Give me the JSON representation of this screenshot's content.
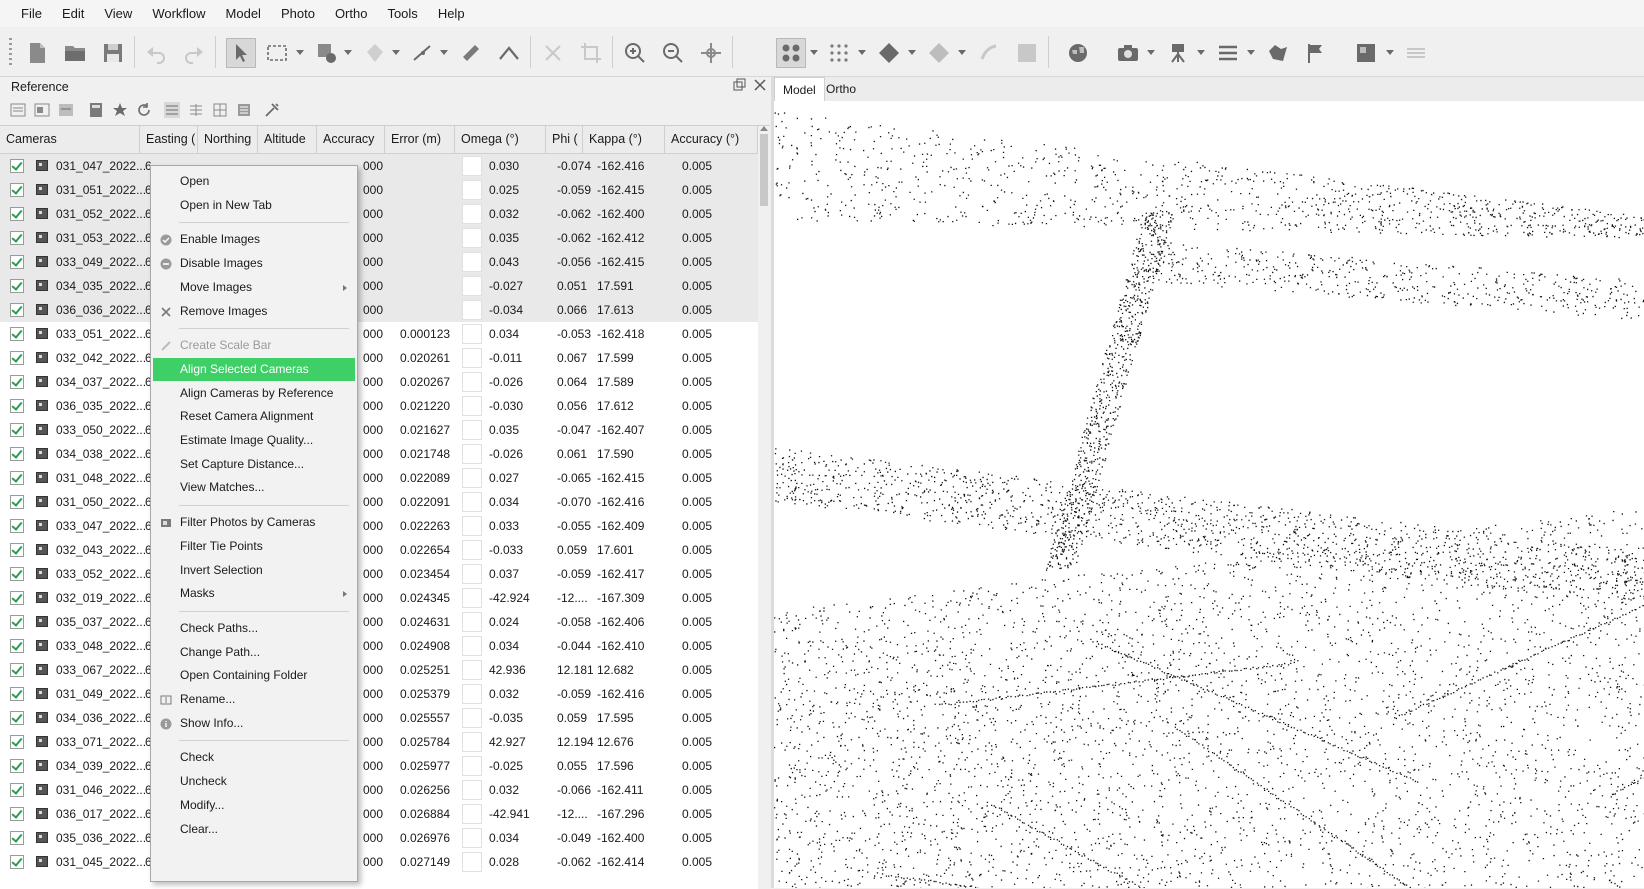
{
  "menubar": [
    "File",
    "Edit",
    "View",
    "Workflow",
    "Model",
    "Photo",
    "Ortho",
    "Tools",
    "Help"
  ],
  "panel": {
    "title": "Reference"
  },
  "columns": [
    "Cameras",
    "Easting (",
    "Northing",
    "Altitude",
    "Accuracy",
    "Error (m)",
    "Omega (°)",
    "Phi (",
    "Kappa (°)",
    "Accuracy (°)"
  ],
  "rows": [
    {
      "name": "031_047_2022...",
      "east": "6",
      "acc": "000",
      "err": "",
      "omega": "0.030",
      "phi": "-0.074",
      "kappa": "-162.416",
      "acc2": "0.005",
      "sel": true
    },
    {
      "name": "031_051_2022...",
      "east": "6",
      "acc": "000",
      "err": "",
      "omega": "0.025",
      "phi": "-0.059",
      "kappa": "-162.415",
      "acc2": "0.005",
      "sel": true
    },
    {
      "name": "031_052_2022...",
      "east": "6",
      "acc": "000",
      "err": "",
      "omega": "0.032",
      "phi": "-0.062",
      "kappa": "-162.400",
      "acc2": "0.005",
      "sel": true
    },
    {
      "name": "031_053_2022...",
      "east": "6",
      "acc": "000",
      "err": "",
      "omega": "0.035",
      "phi": "-0.062",
      "kappa": "-162.412",
      "acc2": "0.005",
      "sel": true
    },
    {
      "name": "033_049_2022...",
      "east": "6",
      "acc": "000",
      "err": "",
      "omega": "0.043",
      "phi": "-0.056",
      "kappa": "-162.415",
      "acc2": "0.005",
      "sel": true
    },
    {
      "name": "034_035_2022...",
      "east": "6",
      "acc": "000",
      "err": "",
      "omega": "-0.027",
      "phi": "0.051",
      "kappa": "17.591",
      "acc2": "0.005",
      "sel": true
    },
    {
      "name": "036_036_2022...",
      "east": "6",
      "acc": "000",
      "err": "",
      "omega": "-0.034",
      "phi": "0.066",
      "kappa": "17.613",
      "acc2": "0.005",
      "sel": true
    },
    {
      "name": "033_051_2022...",
      "east": "6",
      "acc": "000",
      "err": "0.000123",
      "omega": "0.034",
      "phi": "-0.053",
      "kappa": "-162.418",
      "acc2": "0.005",
      "sel": false
    },
    {
      "name": "032_042_2022...",
      "east": "6",
      "acc": "000",
      "err": "0.020261",
      "omega": "-0.011",
      "phi": "0.067",
      "kappa": "17.599",
      "acc2": "0.005",
      "sel": false
    },
    {
      "name": "034_037_2022...",
      "east": "6",
      "acc": "000",
      "err": "0.020267",
      "omega": "-0.026",
      "phi": "0.064",
      "kappa": "17.589",
      "acc2": "0.005",
      "sel": false
    },
    {
      "name": "036_035_2022...",
      "east": "6",
      "acc": "000",
      "err": "0.021220",
      "omega": "-0.030",
      "phi": "0.056",
      "kappa": "17.612",
      "acc2": "0.005",
      "sel": false
    },
    {
      "name": "033_050_2022...",
      "east": "6",
      "acc": "000",
      "err": "0.021627",
      "omega": "0.035",
      "phi": "-0.047",
      "kappa": "-162.407",
      "acc2": "0.005",
      "sel": false
    },
    {
      "name": "034_038_2022...",
      "east": "6",
      "acc": "000",
      "err": "0.021748",
      "omega": "-0.026",
      "phi": "0.061",
      "kappa": "17.590",
      "acc2": "0.005",
      "sel": false
    },
    {
      "name": "031_048_2022...",
      "east": "6",
      "acc": "000",
      "err": "0.022089",
      "omega": "0.027",
      "phi": "-0.065",
      "kappa": "-162.415",
      "acc2": "0.005",
      "sel": false
    },
    {
      "name": "031_050_2022...",
      "east": "6",
      "acc": "000",
      "err": "0.022091",
      "omega": "0.034",
      "phi": "-0.070",
      "kappa": "-162.416",
      "acc2": "0.005",
      "sel": false
    },
    {
      "name": "033_047_2022...",
      "east": "6",
      "acc": "000",
      "err": "0.022263",
      "omega": "0.033",
      "phi": "-0.055",
      "kappa": "-162.409",
      "acc2": "0.005",
      "sel": false
    },
    {
      "name": "032_043_2022...",
      "east": "6",
      "acc": "000",
      "err": "0.022654",
      "omega": "-0.033",
      "phi": "0.059",
      "kappa": "17.601",
      "acc2": "0.005",
      "sel": false
    },
    {
      "name": "033_052_2022...",
      "east": "6",
      "acc": "000",
      "err": "0.023454",
      "omega": "0.037",
      "phi": "-0.059",
      "kappa": "-162.417",
      "acc2": "0.005",
      "sel": false
    },
    {
      "name": "032_019_2022...",
      "east": "6",
      "acc": "000",
      "err": "0.024345",
      "omega": "-42.924",
      "phi": "-12....",
      "kappa": "-167.309",
      "acc2": "0.005",
      "sel": false
    },
    {
      "name": "035_037_2022...",
      "east": "6",
      "acc": "000",
      "err": "0.024631",
      "omega": "0.024",
      "phi": "-0.058",
      "kappa": "-162.406",
      "acc2": "0.005",
      "sel": false
    },
    {
      "name": "033_048_2022...",
      "east": "6",
      "acc": "000",
      "err": "0.024908",
      "omega": "0.034",
      "phi": "-0.044",
      "kappa": "-162.410",
      "acc2": "0.005",
      "sel": false
    },
    {
      "name": "033_067_2022...",
      "east": "6",
      "acc": "000",
      "err": "0.025251",
      "omega": "42.936",
      "phi": "12.181",
      "kappa": "12.682",
      "acc2": "0.005",
      "sel": false
    },
    {
      "name": "031_049_2022...",
      "east": "6",
      "acc": "000",
      "err": "0.025379",
      "omega": "0.032",
      "phi": "-0.059",
      "kappa": "-162.416",
      "acc2": "0.005",
      "sel": false
    },
    {
      "name": "034_036_2022...",
      "east": "6",
      "acc": "000",
      "err": "0.025557",
      "omega": "-0.035",
      "phi": "0.059",
      "kappa": "17.595",
      "acc2": "0.005",
      "sel": false
    },
    {
      "name": "033_071_2022...",
      "east": "6",
      "acc": "000",
      "err": "0.025784",
      "omega": "42.927",
      "phi": "12.194",
      "kappa": "12.676",
      "acc2": "0.005",
      "sel": false
    },
    {
      "name": "034_039_2022...",
      "east": "6",
      "acc": "000",
      "err": "0.025977",
      "omega": "-0.025",
      "phi": "0.055",
      "kappa": "17.596",
      "acc2": "0.005",
      "sel": false
    },
    {
      "name": "031_046_2022...",
      "east": "6",
      "acc": "000",
      "err": "0.026256",
      "omega": "0.032",
      "phi": "-0.066",
      "kappa": "-162.411",
      "acc2": "0.005",
      "sel": false
    },
    {
      "name": "036_017_2022...",
      "east": "6",
      "acc": "000",
      "err": "0.026884",
      "omega": "-42.941",
      "phi": "-12....",
      "kappa": "-167.296",
      "acc2": "0.005",
      "sel": false
    },
    {
      "name": "035_036_2022...",
      "east": "6",
      "acc": "000",
      "err": "0.026976",
      "omega": "0.034",
      "phi": "-0.049",
      "kappa": "-162.400",
      "acc2": "0.005",
      "sel": false
    },
    {
      "name": "031_045_2022...",
      "east": "6",
      "acc": "000",
      "err": "0.027149",
      "omega": "0.028",
      "phi": "-0.062",
      "kappa": "-162.414",
      "acc2": "0.005",
      "sel": false
    }
  ],
  "context_menu": [
    {
      "label": "Open"
    },
    {
      "label": "Open in New Tab"
    },
    {
      "sep": true
    },
    {
      "label": "Enable Images",
      "icon": "enable-icon"
    },
    {
      "label": "Disable Images",
      "icon": "disable-icon"
    },
    {
      "label": "Move Images",
      "submenu": true
    },
    {
      "label": "Remove Images",
      "icon": "remove-icon"
    },
    {
      "sep": true
    },
    {
      "label": "Create Scale Bar",
      "icon": "scale-bar-icon",
      "disabled": true
    },
    {
      "label": "Align Selected Cameras",
      "highlight": true
    },
    {
      "label": "Align Cameras by Reference"
    },
    {
      "label": "Reset Camera Alignment"
    },
    {
      "label": "Estimate Image Quality..."
    },
    {
      "label": "Set Capture Distance..."
    },
    {
      "label": "View Matches..."
    },
    {
      "sep": true
    },
    {
      "label": "Filter Photos by Cameras",
      "icon": "filter-photos-icon"
    },
    {
      "label": "Filter Tie Points"
    },
    {
      "label": "Invert Selection"
    },
    {
      "label": "Masks",
      "submenu": true
    },
    {
      "sep": true
    },
    {
      "label": "Check Paths..."
    },
    {
      "label": "Change Path..."
    },
    {
      "label": "Open Containing Folder"
    },
    {
      "label": "Rename...",
      "icon": "rename-icon"
    },
    {
      "label": "Show Info...",
      "icon": "info-icon"
    },
    {
      "sep": true
    },
    {
      "label": "Check"
    },
    {
      "label": "Uncheck"
    },
    {
      "label": "Modify..."
    },
    {
      "label": "Clear..."
    }
  ],
  "tabs": [
    "Model",
    "Ortho"
  ],
  "colors": {
    "highlight": "#3ecf67",
    "check": "#1fa34a"
  }
}
